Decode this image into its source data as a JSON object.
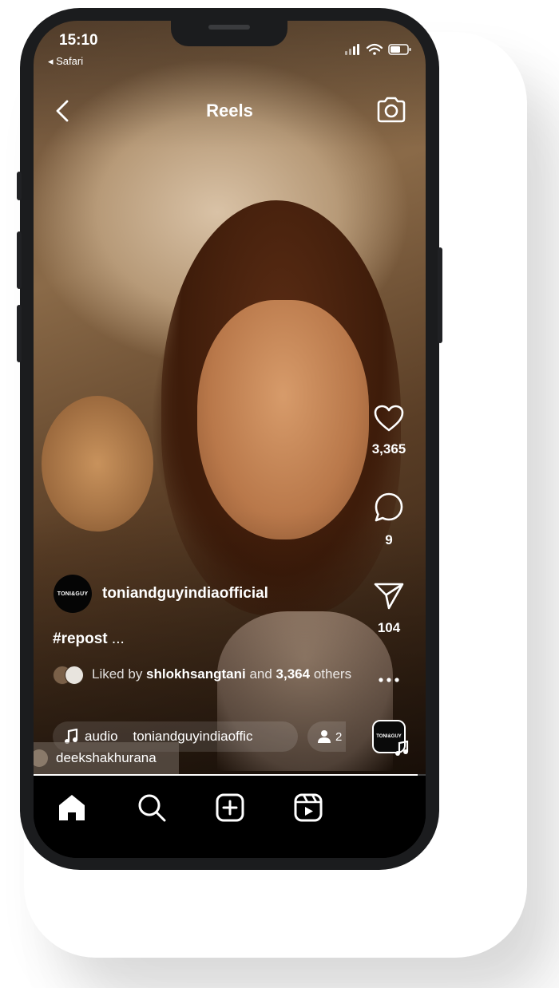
{
  "status_bar": {
    "time": "15:10",
    "back_app": "◂ Safari"
  },
  "header": {
    "title": "Reels"
  },
  "actions": {
    "like_count": "3,365",
    "comment_count": "9",
    "share_count": "104"
  },
  "post": {
    "avatar_text": "TONI&GUY",
    "username": "toniandguyindiaofficial",
    "caption_tag": "#repost",
    "caption_more": " ...",
    "liked_by_prefix": "Liked by ",
    "liked_by_user": "shlokhsangtani",
    "liked_by_mid": " and ",
    "liked_by_count": "3,364",
    "liked_by_suffix": " others",
    "audio_text": "audio    toniandguyindiaoffic",
    "people_count": "2",
    "tagged_user": "deekshakhurana",
    "audio_thumb_text": "TONI&GUY"
  },
  "playback": {
    "progress": 0.98
  },
  "tabs": [
    "home",
    "search",
    "create",
    "reels"
  ],
  "colors": {
    "phone_frame": "#1b1c1e",
    "tabbar": "#000000",
    "text": "#ffffff"
  }
}
